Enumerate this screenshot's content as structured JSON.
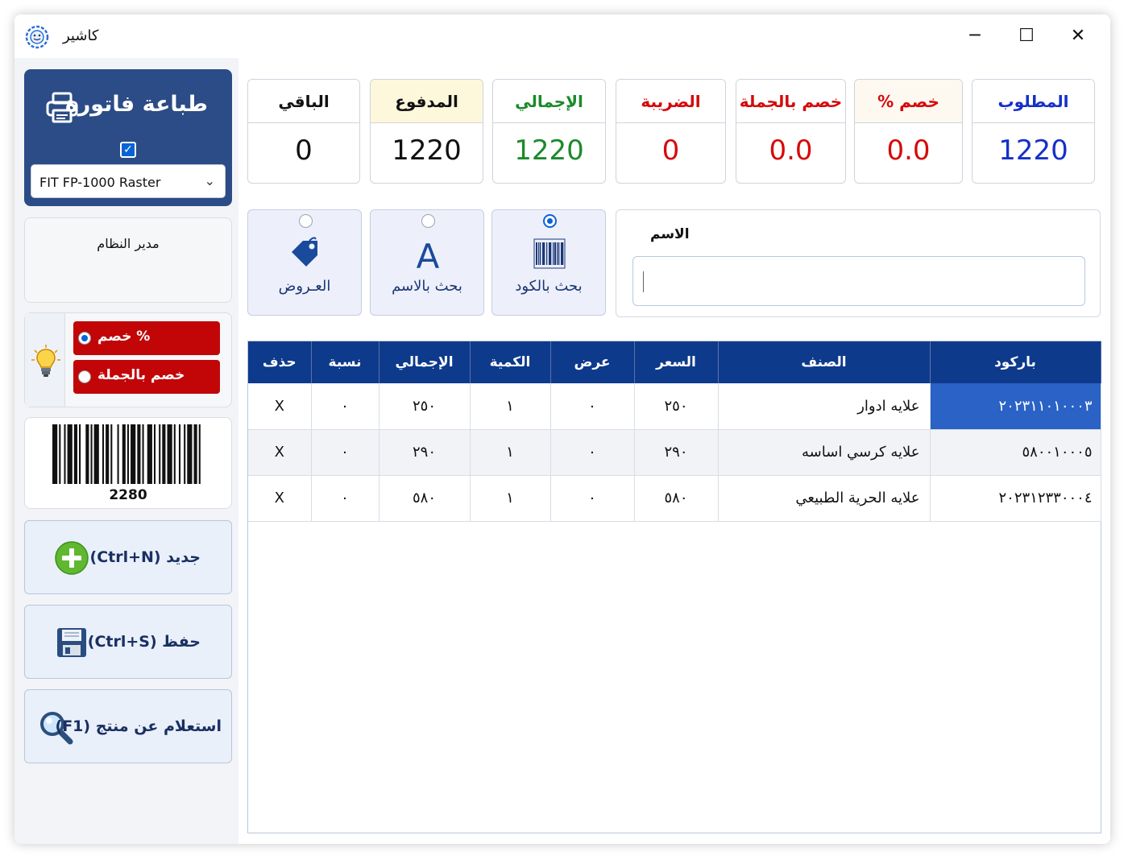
{
  "window": {
    "title": "كاشير",
    "min": "─",
    "max": "☐",
    "close": "✕"
  },
  "print_panel": {
    "title": "طباعة فاتورة",
    "checked": true,
    "printer": "FIT FP-1000 Raster"
  },
  "user": {
    "name": "مدير النظام"
  },
  "discount": {
    "option_percent": "% خصم",
    "option_bulk": "خصم بالجملة",
    "selected": "percent"
  },
  "barcode": {
    "number": "2280"
  },
  "actions": {
    "new_label": "جديد (Ctrl+N)",
    "save_label": "حفظ (Ctrl+S)",
    "query_label": "استعلام عن منتج (F1)"
  },
  "summary": [
    {
      "key": "remaining",
      "label": "الباقي",
      "value": "0",
      "label_color": "#111111",
      "value_color": "#111111",
      "head_bg": "#ffffff"
    },
    {
      "key": "paid",
      "label": "المدفوع",
      "value": "1220",
      "label_color": "#111111",
      "value_color": "#111111",
      "head_bg": "#fdf8dc"
    },
    {
      "key": "total",
      "label": "الإجمالي",
      "value": "1220",
      "label_color": "#1b8a2a",
      "value_color": "#1b8a2a",
      "head_bg": "#ffffff"
    },
    {
      "key": "tax",
      "label": "الضريبة",
      "value": "0",
      "label_color": "#d50a0a",
      "value_color": "#d50a0a",
      "head_bg": "#ffffff"
    },
    {
      "key": "bulk_discount",
      "label": "خصم بالجملة",
      "value": "0.0",
      "label_color": "#d50a0a",
      "value_color": "#d50a0a",
      "head_bg": "#ffffff"
    },
    {
      "key": "percent_discount",
      "label": "خصم %",
      "value": "0.0",
      "label_color": "#d50a0a",
      "value_color": "#d50a0a",
      "head_bg": "#fdf8f0"
    },
    {
      "key": "required",
      "label": "المطلوب",
      "value": "1220",
      "label_color": "#1530c8",
      "value_color": "#1530c8",
      "head_bg": "#ffffff"
    }
  ],
  "search_modes": [
    {
      "key": "offers",
      "label": "العـروض",
      "icon": "tag-icon",
      "selected": false
    },
    {
      "key": "by_name",
      "label": "بحث بالاسم",
      "icon": "letter-a-icon",
      "selected": false
    },
    {
      "key": "by_code",
      "label": "بحث بالكود",
      "icon": "barcode-icon",
      "selected": true
    }
  ],
  "name_search": {
    "label": "الاسم",
    "value": ""
  },
  "table": {
    "headers": [
      "حذف",
      "نسبة",
      "الإجمالي",
      "الكمية",
      "عرض",
      "السعر",
      "الصنف",
      "باركود"
    ],
    "rows": [
      [
        "X",
        "٠",
        "٢٥٠",
        "١",
        "٠",
        "٢٥٠",
        "علايه ادوار",
        "٢٠٢٣١١٠١٠٠٠٣"
      ],
      [
        "X",
        "٠",
        "٢٩٠",
        "١",
        "٠",
        "٢٩٠",
        "علايه كرسي اساسه",
        "٥٨٠٠١٠٠٠٥"
      ],
      [
        "X",
        "٠",
        "٥٨٠",
        "١",
        "٠",
        "٥٨٠",
        "علايه الحرية الطبيعي",
        "٢٠٢٣١٢٣٣٠٠٠٤"
      ]
    ],
    "selected_cell": "0.barcode"
  },
  "colors": {
    "accent": "#2b4c86",
    "header": "#0e3a8c",
    "danger": "#c20608",
    "selection": "#2a62c6"
  }
}
